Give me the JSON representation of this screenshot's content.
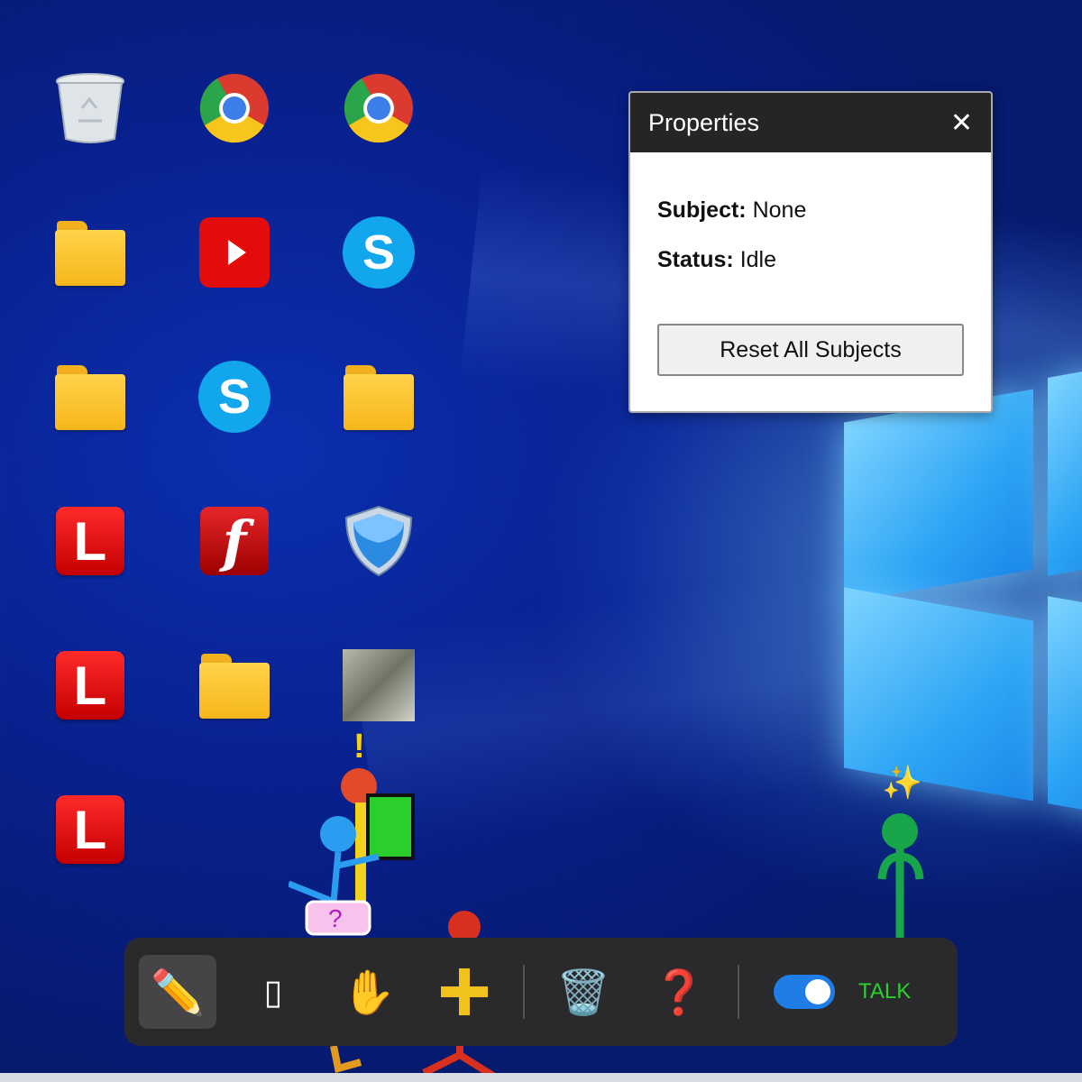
{
  "desktop": {
    "icons": [
      {
        "name": "recycle-bin-icon"
      },
      {
        "name": "chrome-icon"
      },
      {
        "name": "chrome-icon"
      },
      {
        "name": "folder-icon"
      },
      {
        "name": "youtube-icon"
      },
      {
        "name": "skype-icon",
        "glyph": "S"
      },
      {
        "name": "folder-icon"
      },
      {
        "name": "skype-icon",
        "glyph": "S"
      },
      {
        "name": "folder-icon"
      },
      {
        "name": "app-l-icon",
        "glyph": "L"
      },
      {
        "name": "flash-icon",
        "glyph": "f"
      },
      {
        "name": "shield-icon"
      },
      {
        "name": "app-l-icon",
        "glyph": "L"
      },
      {
        "name": "folder-icon"
      },
      {
        "name": "photo-icon"
      },
      {
        "name": "app-l-icon",
        "glyph": "L"
      }
    ]
  },
  "dialog": {
    "title": "Properties",
    "close_glyph": "✕",
    "subject_label": "Subject:",
    "subject_value": "None",
    "status_label": "Status:",
    "status_value": "Idle",
    "reset_label": "Reset All Subjects"
  },
  "toolbar": {
    "pencil_glyph": "✏️",
    "eraser_glyph": "▯",
    "hand_glyph": "✋",
    "add_glyph": "➕",
    "trash_glyph": "🗑️",
    "help_glyph": "❓",
    "toggle_on": true,
    "talk_label": "TALK"
  },
  "figures": {
    "alert_glyph": "!",
    "sparkle_glyph": "✨",
    "question_glyph": "?"
  },
  "colors": {
    "accent_toggle": "#1e7de6",
    "talk_green": "#2bd12b",
    "dialog_header": "#252525"
  }
}
